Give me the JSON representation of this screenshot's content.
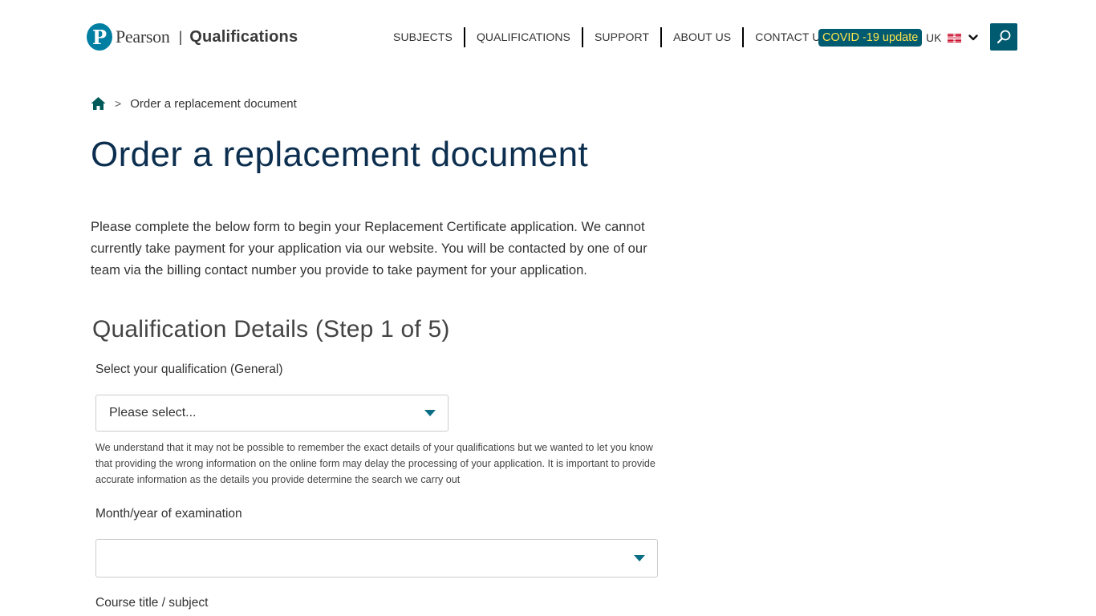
{
  "header": {
    "logo": {
      "mark": "P",
      "brand": "Pearson",
      "separator": "|",
      "product": "Qualifications"
    },
    "nav": [
      {
        "label": "SUBJECTS"
      },
      {
        "label": "QUALIFICATIONS"
      },
      {
        "label": "SUPPORT"
      },
      {
        "label": "ABOUT US"
      },
      {
        "label": "CONTACT US"
      }
    ],
    "covid_badge": "COVID -19 update",
    "locale": {
      "label": "UK",
      "flag_icon": "uk-flag-icon",
      "chevron_icon": "chevron-down-icon"
    },
    "search_icon": "search-icon",
    "colors": {
      "brand_teal": "#007fa3",
      "dark_teal": "#005a70",
      "covid_text": "#ffe44d",
      "title_navy": "#0d2f4f"
    }
  },
  "breadcrumb": {
    "home_icon": "home-icon",
    "separator": ">",
    "current": "Order a replacement document"
  },
  "page": {
    "title": "Order a replacement document",
    "intro": "Please complete the below form to begin your Replacement Certificate application. We cannot currently take payment for your application via our website. You will be contacted by one of our team via the billing contact number you provide to take payment for your application."
  },
  "form": {
    "section_title": "Qualification Details (Step 1 of 5)",
    "qualification": {
      "label": "Select your qualification (General)",
      "value": "Please select...",
      "help": "We understand that it may not be possible to remember the exact details of your qualifications but we wanted to let you know that providing the wrong information on the online form may delay the processing of your application. It is important to provide accurate information as the details you provide determine the search we carry out"
    },
    "exam_date": {
      "label": "Month/year of examination",
      "value": ""
    },
    "course": {
      "label": "Course title / subject"
    }
  }
}
